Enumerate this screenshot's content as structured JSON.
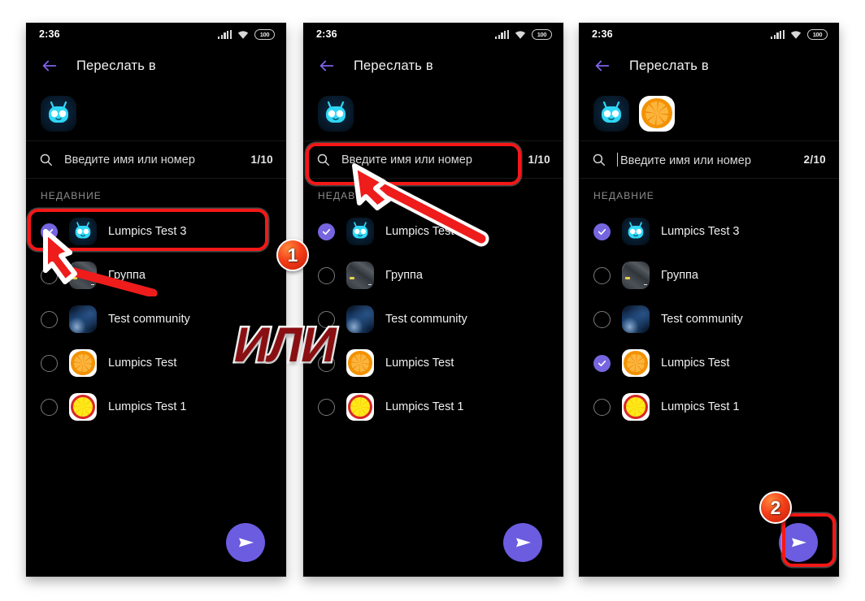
{
  "statusbar": {
    "time": "2:36",
    "battery_level": "100",
    "icons": [
      "signal-icon",
      "wifi-icon",
      "battery-icon"
    ]
  },
  "appbar": {
    "back_label": "back-arrow",
    "title": "Переслать в"
  },
  "search": {
    "placeholder": "Введите имя или номер",
    "icon": "search-icon"
  },
  "list": {
    "section_label": "НЕДАВНИЕ",
    "contacts": [
      {
        "name": "Lumpics Test 3",
        "avatar": "robot"
      },
      {
        "name": "Группа",
        "avatar": "city"
      },
      {
        "name": "Test community",
        "avatar": "nebula"
      },
      {
        "name": "Lumpics Test",
        "avatar": "orange"
      },
      {
        "name": "Lumpics Test 1",
        "avatar": "lemon"
      }
    ]
  },
  "panels": [
    {
      "id": "panel-1",
      "counter": "1/10",
      "chips": [
        "robot"
      ],
      "selected": [
        true,
        false,
        false,
        false,
        false
      ],
      "send_button": "send-icon"
    },
    {
      "id": "panel-2",
      "counter": "1/10",
      "chips": [
        "robot"
      ],
      "selected": [
        true,
        false,
        false,
        false,
        false
      ],
      "send_button": "send-icon"
    },
    {
      "id": "panel-3",
      "counter": "2/10",
      "chips": [
        "robot",
        "orange"
      ],
      "selected": [
        true,
        false,
        false,
        true,
        false
      ],
      "send_button": "send-icon"
    }
  ],
  "annotations": {
    "or_text": "ИЛИ",
    "badge_one": "1",
    "badge_two": "2",
    "highlight_color": "#f51717",
    "accent_color": "#6b5ce0"
  }
}
